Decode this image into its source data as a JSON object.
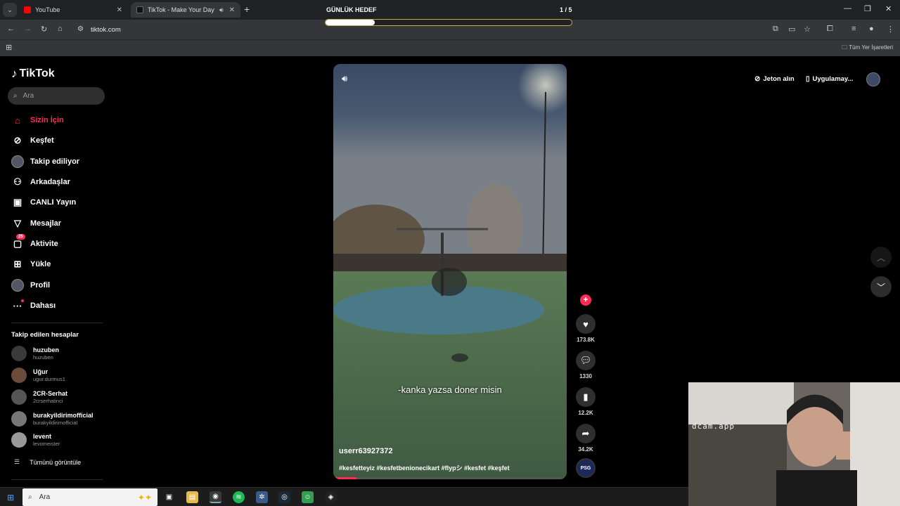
{
  "browser": {
    "tabs": [
      {
        "title": "YouTube",
        "favicon_color": "#ff0000"
      },
      {
        "title": "TikTok - Make Your Day",
        "favicon_color": "#111111"
      }
    ],
    "goal_label": "GÜNLÜK HEDEF",
    "goal_count": "1 / 5",
    "goal_progress": 0.2,
    "url": "tiktok.com",
    "bookmarks_all": "Tüm Yer İşaretleri"
  },
  "tiktok": {
    "brand": "TikTok",
    "search_placeholder": "Ara",
    "nav": [
      {
        "label": "Sizin İçin",
        "icon": "home-icon",
        "glyph": "⌂",
        "active": true
      },
      {
        "label": "Keşfet",
        "icon": "compass-icon",
        "glyph": "⊘"
      },
      {
        "label": "Takip ediliyor",
        "icon": "avatar"
      },
      {
        "label": "Arkadaşlar",
        "icon": "friends-icon",
        "glyph": "⚇"
      },
      {
        "label": "CANLI Yayın",
        "icon": "live-icon",
        "glyph": "▣"
      },
      {
        "label": "Mesajlar",
        "icon": "send-icon",
        "glyph": "▽"
      },
      {
        "label": "Aktivite",
        "icon": "activity-icon",
        "glyph": "▢",
        "badge": "25"
      },
      {
        "label": "Yükle",
        "icon": "upload-icon",
        "glyph": "⊞"
      },
      {
        "label": "Profil",
        "icon": "avatar"
      },
      {
        "label": "Dahası",
        "icon": "more-icon",
        "glyph": "···"
      }
    ],
    "following_title": "Takip edilen hesaplar",
    "accounts": [
      {
        "name": "huzuben",
        "handle": "huzuben",
        "color": "#3a3a3a"
      },
      {
        "name": "Uğur",
        "handle": "ugur.durmus1",
        "color": "#6a4a3a"
      },
      {
        "name": "2CR-Serhat",
        "handle": "2crserhatinci",
        "color": "#555555"
      },
      {
        "name": "burakyildirimofficial",
        "handle": "burakyildirimofficial",
        "color": "#777777"
      },
      {
        "name": "levent",
        "handle": "levomeister",
        "color": "#999999"
      }
    ],
    "see_all": "Tümünü görüntüle",
    "video": {
      "caption": "-kanka yazsa doner misin",
      "author": "userr63927372",
      "hashtags": "#kesfetteyiz #kesfetbenionecikart #flypシ #kesfet #keşfet",
      "progress": 0.1
    },
    "actions": {
      "likes": "173.8K",
      "comments": "1330",
      "saves": "12.2K",
      "shares": "34.2K"
    },
    "get_coins": "Jeton alın",
    "get_app": "Uygulamay..."
  },
  "webcam": {
    "watermark": "dcam.app"
  },
  "taskbar": {
    "search_placeholder": "Ara"
  }
}
